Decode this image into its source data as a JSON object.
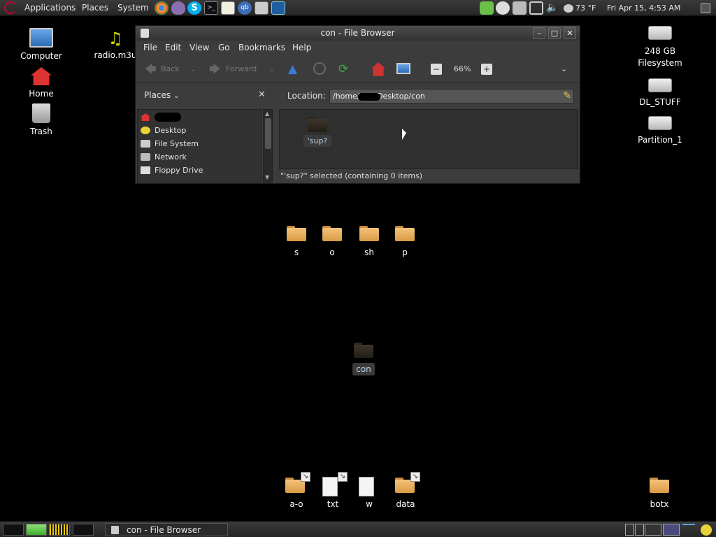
{
  "top_panel": {
    "menus": [
      "Applications",
      "Places",
      "System"
    ],
    "weather": "73 °F",
    "clock": "Fri Apr 15,  4:53 AM"
  },
  "desktop": {
    "left_icons": [
      {
        "name": "computer",
        "label": "Computer"
      },
      {
        "name": "home",
        "label": "Home"
      },
      {
        "name": "trash",
        "label": "Trash"
      }
    ],
    "radio_label": "radio.m3u",
    "drives": [
      {
        "label_1": "248 GB",
        "label_2": "Filesystem"
      },
      {
        "label_1": "DL_STUFF",
        "label_2": ""
      },
      {
        "label_1": "Partition_1",
        "label_2": ""
      }
    ],
    "middle_folders": [
      "s",
      "o",
      "sh",
      "p"
    ],
    "con_label": "con",
    "bottom_items": [
      "a-o",
      "txt",
      "w",
      "data"
    ],
    "botx_label": "botx"
  },
  "window": {
    "title": "con - File Browser",
    "menus": [
      "File",
      "Edit",
      "View",
      "Go",
      "Bookmarks",
      "Help"
    ],
    "toolbar": {
      "back": "Back",
      "forward": "Forward",
      "zoom": "66%"
    },
    "sidebar_header": "Places",
    "location_label": "Location:",
    "location_value": "/home/       Desktop/con",
    "places": [
      "",
      "Desktop",
      "File System",
      "Network",
      "Floppy Drive"
    ],
    "item_label": "'sup?",
    "status": "\"'sup?\" selected (containing 0 items)"
  },
  "bottom_panel": {
    "task_title": "con - File Browser"
  }
}
